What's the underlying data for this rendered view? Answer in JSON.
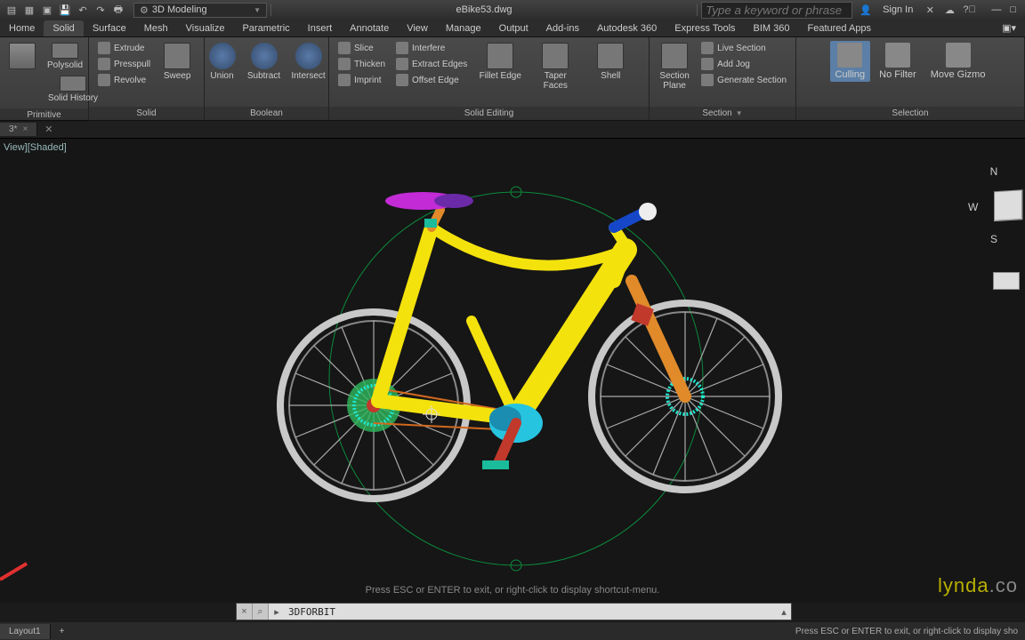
{
  "title": "eBike53.dwg",
  "workspace": "3D Modeling",
  "search_placeholder": "Type a keyword or phrase",
  "signin": "Sign In",
  "tabs": [
    "Home",
    "Solid",
    "Surface",
    "Mesh",
    "Visualize",
    "Parametric",
    "Insert",
    "Annotate",
    "View",
    "Manage",
    "Output",
    "Add-ins",
    "Autodesk 360",
    "Express Tools",
    "BIM 360",
    "Featured Apps"
  ],
  "active_tab": "Solid",
  "ribbon": {
    "primitive": {
      "title": "Primitive",
      "box": "Box",
      "polysolid": "Polysolid",
      "history": "Solid History"
    },
    "solid": {
      "title": "Solid",
      "extrude": "Extrude",
      "presspull": "Presspull",
      "revolve": "Revolve",
      "sweep": "Sweep"
    },
    "boolean": {
      "title": "Boolean",
      "union": "Union",
      "subtract": "Subtract",
      "intersect": "Intersect"
    },
    "solidedit": {
      "title": "Solid Editing",
      "slice": "Slice",
      "thicken": "Thicken",
      "imprint": "Imprint",
      "interfere": "Interfere",
      "extract": "Extract Edges",
      "offset": "Offset Edge",
      "fillet": "Fillet Edge",
      "taper": "Taper Faces",
      "shell": "Shell"
    },
    "section": {
      "title": "Section",
      "plane": "Section Plane",
      "live": "Live Section",
      "jog": "Add Jog",
      "generate": "Generate Section"
    },
    "selection": {
      "title": "Selection",
      "culling": "Culling",
      "nofilter": "No Filter",
      "gizmo": "Move Gizmo"
    }
  },
  "doc_tab": "3*",
  "view_label": "View][Shaded]",
  "hint": "Press ESC or ENTER to exit, or right-click to display shortcut-menu.",
  "cmd": "3DFORBIT",
  "layout_tab": "Layout1",
  "status_right": "Press ESC or ENTER to exit, or right-click to display sho",
  "watermark_a": "lynda",
  "watermark_b": ".co",
  "nav": {
    "n": "N",
    "w": "W",
    "s": "S"
  }
}
